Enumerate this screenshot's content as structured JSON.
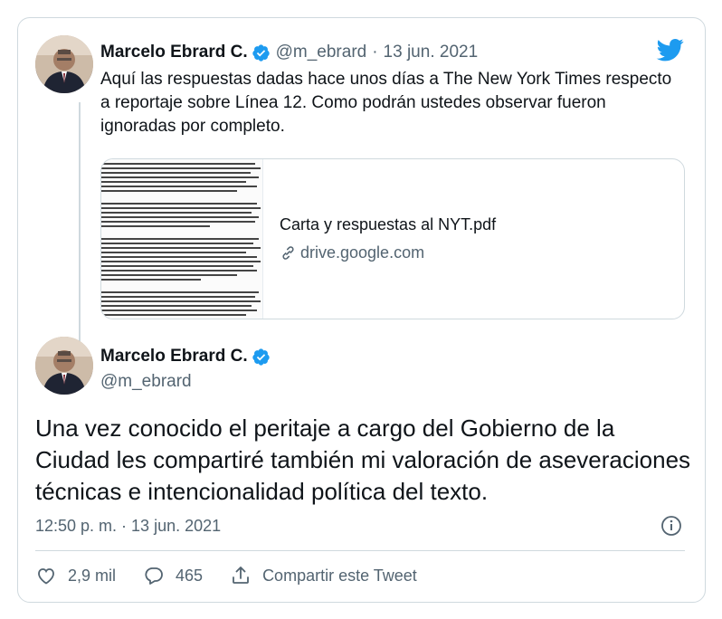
{
  "tweet1": {
    "author_name": "Marcelo Ebrard C.",
    "handle": "@m_ebrard",
    "separator": "·",
    "date": "13 jun. 2021",
    "text": "Aquí las respuestas dadas hace unos días a The  New York Times respecto a reportaje sobre Línea 12. Como podrán ustedes observar fueron ignoradas por completo.",
    "link_card": {
      "title": "Carta y respuestas al NYT.pdf",
      "domain": "drive.google.com"
    }
  },
  "tweet2": {
    "author_name": "Marcelo Ebrard C.",
    "handle": "@m_ebrard",
    "text": "Una vez conocido el peritaje a cargo del Gobierno de la Ciudad les compartiré también mi valoración de aseveraciones técnicas e intencionalidad política del texto.",
    "timestamp": "12:50 p. m. · 13 jun. 2021"
  },
  "actions": {
    "like_count": "2,9 mil",
    "reply_count": "465",
    "share_label": "Compartir este Tweet"
  },
  "colors": {
    "accent": "#1d9bf0",
    "muted": "#536471",
    "border": "#cfd9de"
  },
  "icons": [
    "twitter-bird-icon",
    "verified-badge-icon",
    "link-icon",
    "info-icon",
    "heart-icon",
    "reply-icon",
    "share-icon"
  ]
}
